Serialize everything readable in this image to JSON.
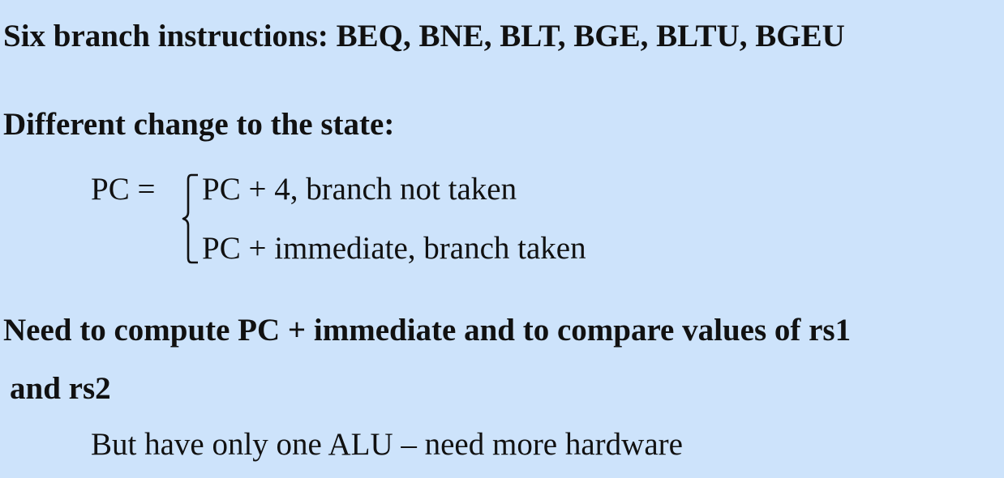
{
  "slide": {
    "heading_branches": "Six branch instructions: BEQ, BNE, BLT, BGE, BLTU, BGEU",
    "heading_state": "Different change to the state:",
    "equation": {
      "lhs": "PC =",
      "case_not_taken": "PC + 4, branch not taken",
      "case_taken": "PC + immediate, branch taken"
    },
    "need_line1": "Need to compute PC + immediate and to compare values of rs1",
    "need_line2": "and rs2",
    "sub_point": "But have only one ALU – need more hardware"
  },
  "colors": {
    "background": "#cde3fb",
    "text": "#111111"
  }
}
